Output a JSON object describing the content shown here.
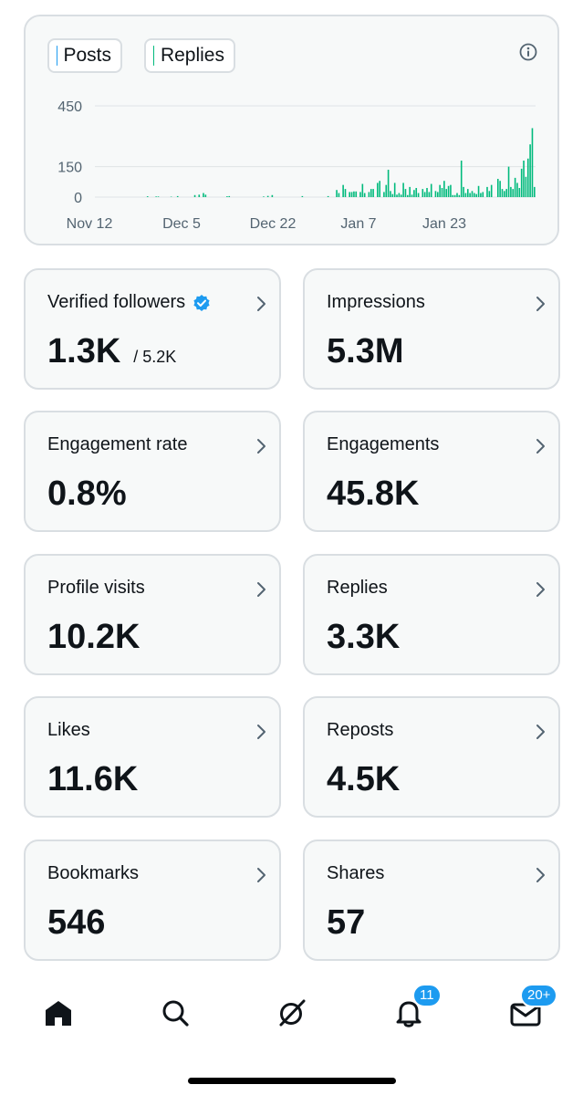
{
  "chart_data": {
    "type": "bar",
    "legend": [
      {
        "name": "Posts",
        "color": "#1d9bf0"
      },
      {
        "name": "Replies",
        "color": "#00ba7c"
      }
    ],
    "x_tick_labels": [
      "Nov 12",
      "Dec 5",
      "Dec 22",
      "Jan 7",
      "Jan 23"
    ],
    "y_tick_labels": [
      "450",
      "150",
      "0"
    ],
    "ylim": [
      0,
      450
    ],
    "grid": true,
    "series": [
      {
        "name": "Replies",
        "values": [
          0,
          0,
          0,
          0,
          0,
          0,
          0,
          0,
          0,
          0,
          0,
          0,
          0,
          0,
          0,
          0,
          0,
          0,
          0,
          0,
          0,
          0,
          0,
          0,
          4,
          0,
          0,
          0,
          3,
          3,
          0,
          0,
          0,
          0,
          0,
          2,
          0,
          0,
          5,
          0,
          0,
          0,
          0,
          0,
          0,
          0,
          10,
          0,
          12,
          0,
          20,
          12,
          0,
          0,
          0,
          0,
          0,
          0,
          0,
          0,
          0,
          4,
          5,
          0,
          0,
          0,
          0,
          0,
          0,
          0,
          0,
          0,
          0,
          0,
          0,
          0,
          0,
          0,
          3,
          0,
          6,
          0,
          10,
          0,
          0,
          0,
          0,
          0,
          0,
          0,
          0,
          0,
          0,
          0,
          0,
          0,
          5,
          0,
          0,
          0,
          0,
          0,
          0,
          0,
          0,
          0,
          0,
          0,
          5,
          0,
          0,
          0,
          35,
          20,
          0,
          60,
          40,
          0,
          25,
          25,
          28,
          28,
          0,
          25,
          65,
          20,
          0,
          25,
          40,
          40,
          0,
          70,
          80,
          0,
          25,
          60,
          135,
          30,
          15,
          70,
          12,
          20,
          12,
          70,
          40,
          10,
          50,
          12,
          35,
          45,
          20,
          0,
          40,
          25,
          45,
          25,
          65,
          0,
          30,
          25,
          60,
          45,
          80,
          40,
          55,
          60,
          10,
          10,
          20,
          10,
          180,
          50,
          20,
          40,
          20,
          30,
          20,
          15,
          55,
          20,
          25,
          0,
          50,
          30,
          60,
          0,
          0,
          90,
          80,
          40,
          30,
          40,
          150,
          50,
          40,
          95,
          70,
          45,
          140,
          180,
          100,
          190,
          260,
          340,
          50
        ]
      }
    ]
  },
  "header": {
    "posts_label": "Posts",
    "replies_label": "Replies",
    "info_icon": "info-icon"
  },
  "stats": [
    {
      "label": "Verified followers",
      "value": "1.3K",
      "sub": "/ 5.2K",
      "verified": true
    },
    {
      "label": "Impressions",
      "value": "5.3M"
    },
    {
      "label": "Engagement rate",
      "value": "0.8%"
    },
    {
      "label": "Engagements",
      "value": "45.8K"
    },
    {
      "label": "Profile visits",
      "value": "10.2K"
    },
    {
      "label": "Replies",
      "value": "3.3K"
    },
    {
      "label": "Likes",
      "value": "11.6K"
    },
    {
      "label": "Reposts",
      "value": "4.5K"
    },
    {
      "label": "Bookmarks",
      "value": "546"
    },
    {
      "label": "Shares",
      "value": "57"
    }
  ],
  "tab_bar": {
    "items": [
      {
        "icon": "home-icon"
      },
      {
        "icon": "search-icon"
      },
      {
        "icon": "grok-icon"
      },
      {
        "icon": "notifications-icon",
        "badge": "11"
      },
      {
        "icon": "messages-icon",
        "badge": "20+"
      }
    ]
  },
  "colors": {
    "accent": "#1d9bf0",
    "replies_green": "#00ba7c",
    "card_bg": "#f7f9f9",
    "card_border": "#d9dee2"
  }
}
